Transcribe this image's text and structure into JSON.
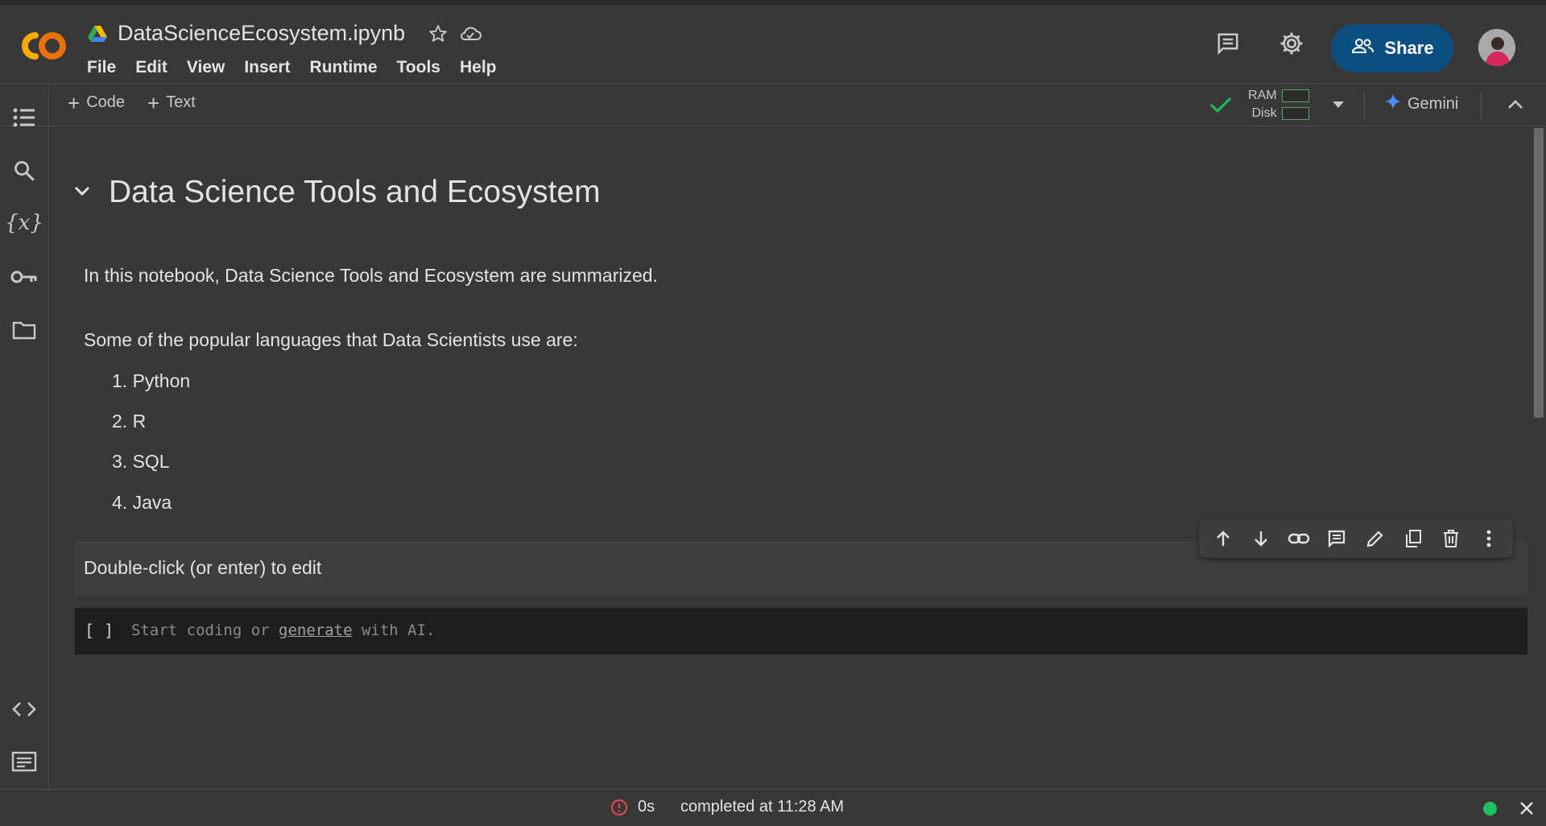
{
  "header": {
    "filename": "DataScienceEcosystem.ipynb",
    "menu": [
      "File",
      "Edit",
      "View",
      "Insert",
      "Runtime",
      "Tools",
      "Help"
    ],
    "share_label": "Share"
  },
  "toolbar": {
    "add_code": "Code",
    "add_text": "Text",
    "ram_label": "RAM",
    "disk_label": "Disk",
    "gemini_label": "Gemini"
  },
  "notebook": {
    "heading": "Data Science Tools and Ecosystem",
    "intro": "In this notebook, Data Science Tools and Ecosystem are summarized.",
    "languages_intro": "Some of the popular languages that Data Scientists use are:",
    "languages": [
      "1. Python",
      "2. R",
      "3. SQL",
      "4. Java"
    ],
    "edit_hint": "Double-click (or enter) to edit",
    "code_cell": {
      "run_indicator": "[ ]",
      "placeholder_before": "Start coding or ",
      "placeholder_link": "generate",
      "placeholder_after": " with AI."
    }
  },
  "status": {
    "duration": "0s",
    "completed": "completed at 11:28 AM"
  },
  "colors": {
    "background": "#383838",
    "share_button": "#0b4f82",
    "status_ok": "#1fc15f",
    "error_icon": "#e5484d",
    "logo_orange": "#f9ab00"
  }
}
